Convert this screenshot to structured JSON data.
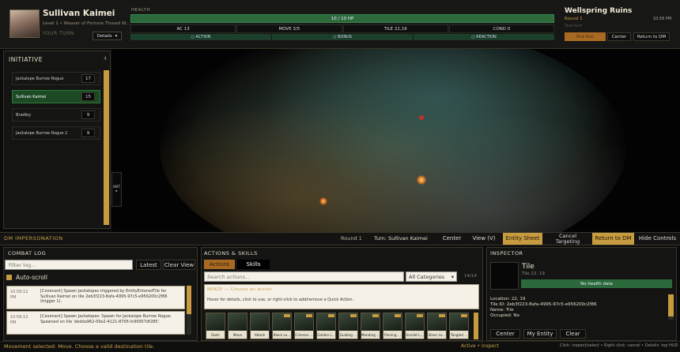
{
  "header": {
    "name": "Sullivan Kaimei",
    "subtitle": "Level 1 • Weaver of Fortune Thread W...",
    "turn_label": "YOUR TURN",
    "details_label": "Details",
    "health_label": "HEALTH",
    "hp": "10 / 10 HP",
    "hp_fraction": 1.0,
    "stats": [
      "AC  13",
      "MOVE  3/5",
      "TILE  22,19",
      "COND  0"
    ],
    "resources": [
      "○  ACTION",
      "○  BONUS",
      "○  REACTION"
    ],
    "location": "Wellspring Ruins",
    "round": "Round 1",
    "time": "10:56 PM",
    "your_turn": "Your turn",
    "end_turn_label": "End Turn",
    "center_label": "Center",
    "return_dm_label": "Return to DM"
  },
  "initiative": {
    "title": "INITIATIVE",
    "count": "4",
    "entries": [
      {
        "name": "Jackalope Burrow Rogue",
        "value": "17"
      },
      {
        "name": "Sullivan Kaimei",
        "value": "15"
      },
      {
        "name": "Bradley",
        "value": "9"
      },
      {
        "name": "Jackalope Burrow Rogue 2",
        "value": "9"
      }
    ],
    "tab_label": "INIT ▸"
  },
  "dm_bar": {
    "title": "DM IMPERSONATION",
    "round": "Round 1",
    "turn": "Turn: Sullivan Kaimei",
    "buttons": [
      "Center",
      "View (V)",
      "Entity Sheet",
      "Cancel Targeting",
      "Return to DM",
      "Hide Controls"
    ]
  },
  "combat_log": {
    "title": "COMBAT LOG",
    "filter_placeholder": "Filter log...",
    "latest_label": "Latest",
    "clear_view_label": "Clear View",
    "autoscroll_label": "Auto-scroll",
    "entries": [
      {
        "time": "10:56:12 PM",
        "text": "[Covenant] Spawn Jackalopes triggered by EntityEnteredTile for Sullivan Kaimei on tile 2eb3f223-8afa-4995-97c5-e956200c2f86 (trigger 1)."
      },
      {
        "time": "10:56:12 PM",
        "text": "[Covenant] Spawn Jackalopes: Spawn for Jackalope Burrow Rogue. Spawned on tile 'ebdda962-09e2-4121-8706-fc99957df285'."
      }
    ]
  },
  "actions": {
    "title": "ACTIONS & SKILLS",
    "tab_actions": "Actions",
    "tab_skills": "Skills",
    "search_placeholder": "Search actions...",
    "category": "All Categories",
    "count": "14/14",
    "ready_title": "READY — Choose an action",
    "ready_hint": "Hover for details, click to use, or right-click to add/remove a Quick Action.",
    "skills": [
      "Dash",
      "Move",
      "Attack",
      "Black Lo...",
      "Crimson ...",
      "Golden L...",
      "Guiding ...",
      "Mending ...",
      "Pinning ...",
      "Scarlet L...",
      "Silver Lo...",
      "Tangled ..."
    ]
  },
  "inspector": {
    "title": "INSPECTOR",
    "entity": "Tile",
    "entity_sub": "Tile 22, 19",
    "health": "No health data",
    "details": [
      "Location: 22, 19",
      "Tile ID: 2eb3f223-8afa-4995-97c5-e956200c2f86",
      "Name: Tile",
      "Occupied: No"
    ],
    "buttons": [
      "Center",
      "My Entity",
      "Clear"
    ]
  },
  "status": {
    "left": "Movement selected: Move. Choose a valid destination tile.",
    "mid": "Active • Inspect",
    "right": "Click: inspect/select  •  Right-click: cancel  •  Details: top HUD"
  },
  "colors": {
    "accent": "#c79b3f",
    "health_green": "#2c6a3c",
    "panel": "#141413"
  }
}
